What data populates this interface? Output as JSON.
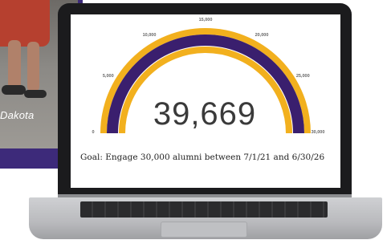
{
  "photo": {
    "caption": "Dakota"
  },
  "gauge": {
    "value": 39669,
    "value_display": "39,669",
    "max": 30000,
    "ticks": [
      "0",
      "5,000",
      "10,000",
      "15,000",
      "20,000",
      "25,000",
      "30,000"
    ],
    "goal_text": "Goal: Engage 30,000 alumni between 7/1/21 and 6/30/26",
    "colors": {
      "outer": "#f2b01e",
      "inner": "#3a1f6e",
      "outline": "#a88c1a"
    }
  }
}
